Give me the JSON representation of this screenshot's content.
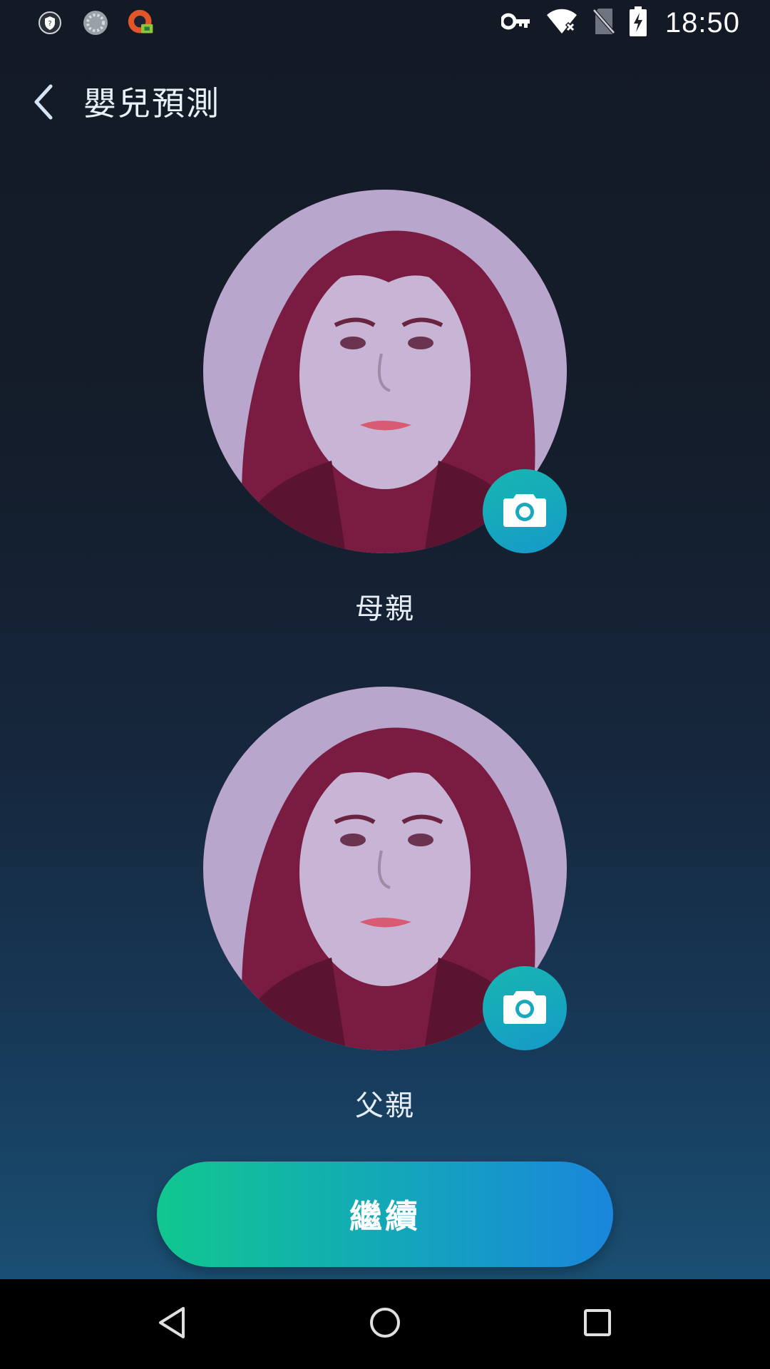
{
  "status_bar": {
    "time": "18:50",
    "left_icons": [
      "shield-app-icon",
      "loading-spinner-icon",
      "vpn-app-icon"
    ],
    "right_icons": [
      "vpn-key-icon",
      "wifi-no-internet-icon",
      "no-sim-icon",
      "battery-charging-icon"
    ]
  },
  "toolbar": {
    "title": "嬰兒預測",
    "back_icon": "chevron-left-icon"
  },
  "mother": {
    "label": "母親",
    "photo_alt": "mother-photo",
    "camera_icon": "camera-icon"
  },
  "father": {
    "label": "父親",
    "photo_alt": "father-photo",
    "camera_icon": "camera-icon"
  },
  "continue_button": {
    "label": "繼續"
  },
  "nav_bar": {
    "back_icon": "triangle-back-icon",
    "home_icon": "circle-home-icon",
    "recents_icon": "square-recents-icon"
  },
  "colors": {
    "background_top": "#131a25",
    "background_bottom": "#1a4f73",
    "accent_green": "#11c78f",
    "accent_blue": "#1a86dc",
    "camera_button": "#17b7b0"
  }
}
